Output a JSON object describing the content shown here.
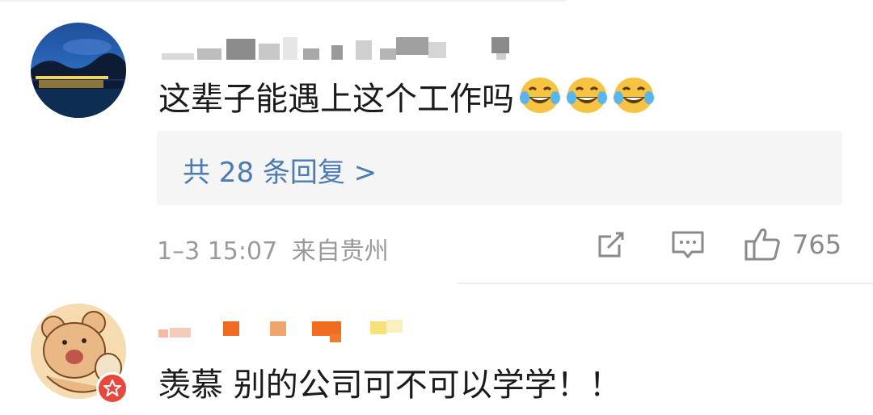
{
  "comments": [
    {
      "text": "这辈子能遇上这个工作吗",
      "emoji_icon": "laughing-tears-emoji-icon",
      "emoji_count": 3,
      "replies_label": "共 28 条回复 >",
      "time": "1–3 15:07",
      "location": "来自贵州",
      "likes": "765"
    },
    {
      "text": "羡慕 别的公司可不可以学学！！",
      "avatar_icon": "cartoon-bear-avatar-icon",
      "badge_icon": "star-badge-icon"
    }
  ],
  "colors": {
    "link": "#4b7bb3",
    "meta": "#9a9a9a",
    "reply_bg": "#f5f5f5",
    "badge": "#e8483b"
  }
}
